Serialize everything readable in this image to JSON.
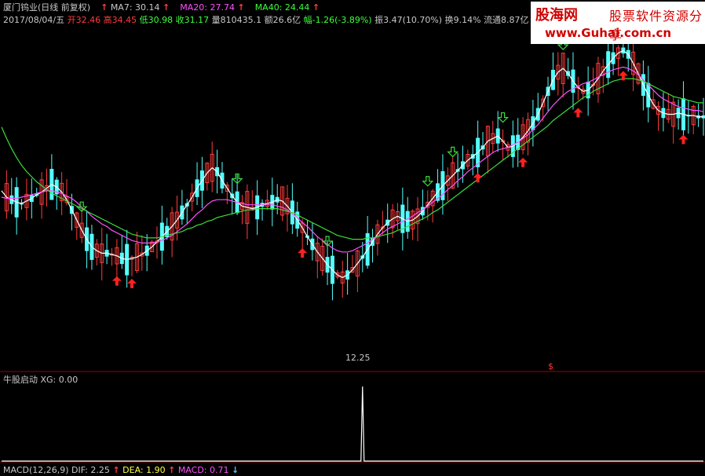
{
  "header": {
    "stock_name": "厦门钨业(日线 前复权)",
    "ma7_label": "MA7: 30.14",
    "ma20_label": "MA20: 27.74",
    "ma40_label": "MA40: 24.44",
    "date": "2017/08/04/五",
    "open": "开32.46",
    "high": "高34.45",
    "low": "低30.98",
    "close": "收31.17",
    "volume": "量810435.1",
    "amount": "额26.6亿",
    "change": "幅-1.26(-3.89%)",
    "amplitude": "振3.47(10.70%)",
    "turnover": "换9.14%",
    "float": "流通8.87亿"
  },
  "watermark": {
    "logo": "股海网",
    "subtitle": "股票软件资源分享",
    "url": "www.Guhai.com.cn"
  },
  "indicator": {
    "title": "牛股启动",
    "xg_label": "XG: 0.00"
  },
  "macd": {
    "label": "MACD(12,26,9)",
    "dif": "DIF: 2.25",
    "dea": "DEA: 1.90",
    "macd": "MACD: 0.71"
  },
  "arrows": {
    "up": "↑",
    "down": "↓"
  },
  "chart_data": {
    "type": "line",
    "title": "",
    "low_marker_label": "12.25",
    "signal_marker_label": "$",
    "colors": {
      "up_candle": "#ff3c3c",
      "down_candle": "#54ffff",
      "ma7": "#ffffff",
      "ma20": "#ff50ff",
      "ma40": "#3cdc3c",
      "buy_arrow": "#ff2020",
      "sell_arrow": "#3cdc3c",
      "xg_line": "#ffffff"
    },
    "y_range": [
      11.0,
      37.0
    ],
    "series": [
      {
        "name": "MA7",
        "values": [
          24.5,
          24.0,
          23.8,
          23.6,
          23.5,
          23.7,
          23.9,
          24.2,
          24.4,
          24.7,
          25.0,
          24.8,
          24.4,
          23.8,
          23.0,
          22.2,
          21.4,
          20.7,
          20.1,
          19.8,
          19.6,
          19.6,
          19.5,
          19.4,
          19.2,
          19.1,
          19.2,
          19.3,
          19.5,
          19.8,
          20.1,
          20.5,
          20.9,
          21.3,
          21.7,
          22.2,
          22.8,
          23.4,
          24.0,
          24.7,
          25.3,
          25.9,
          26.3,
          26.0,
          25.3,
          24.7,
          24.1,
          23.6,
          23.3,
          23.2,
          23.1,
          23.2,
          23.4,
          23.5,
          23.6,
          23.8,
          23.7,
          23.3,
          22.8,
          22.2,
          21.6,
          20.9,
          20.3,
          19.7,
          19.2,
          18.7,
          18.3,
          17.9,
          17.7,
          17.9,
          18.3,
          18.8,
          19.3,
          19.9,
          20.5,
          21.1,
          21.6,
          22.0,
          22.3,
          22.5,
          22.3,
          22.1,
          22.2,
          22.5,
          22.9,
          23.4,
          23.9,
          24.4,
          24.9,
          25.3,
          25.7,
          26.1,
          26.5,
          26.9,
          27.2,
          27.5,
          27.9,
          28.4,
          28.6,
          28.8,
          28.4,
          27.9,
          28.0,
          28.3,
          28.7,
          29.2,
          29.8,
          30.5,
          31.4,
          32.3,
          33.2,
          33.8,
          34.1,
          33.7,
          33.1,
          32.6,
          32.3,
          32.4,
          32.8,
          33.3,
          33.9,
          34.4,
          34.9,
          35.3,
          35.5,
          35.2,
          34.5,
          33.7,
          32.8,
          32.0,
          31.3,
          30.8,
          30.6,
          30.5,
          30.5,
          30.6,
          30.5,
          30.4,
          30.4,
          30.3,
          30.3
        ]
      },
      {
        "name": "MA20",
        "values": [
          24.0,
          23.9,
          23.9,
          23.9,
          24.0,
          24.1,
          24.2,
          24.3,
          24.4,
          24.5,
          24.5,
          24.4,
          24.3,
          24.1,
          23.9,
          23.6,
          23.2,
          22.9,
          22.5,
          22.2,
          21.9,
          21.7,
          21.4,
          21.2,
          21.0,
          20.8,
          20.6,
          20.5,
          20.4,
          20.4,
          20.4,
          20.5,
          20.6,
          20.8,
          21.0,
          21.3,
          21.6,
          21.9,
          22.3,
          22.7,
          23.0,
          23.4,
          23.7,
          23.8,
          23.8,
          23.8,
          23.7,
          23.6,
          23.5,
          23.4,
          23.4,
          23.4,
          23.4,
          23.4,
          23.4,
          23.3,
          23.2,
          23.0,
          22.7,
          22.4,
          22.0,
          21.7,
          21.3,
          20.9,
          20.6,
          20.3,
          20.0,
          19.8,
          19.7,
          19.7,
          19.8,
          20.0,
          20.2,
          20.4,
          20.7,
          20.9,
          21.2,
          21.5,
          21.7,
          21.9,
          22.1,
          22.3,
          22.5,
          22.8,
          23.0,
          23.3,
          23.6,
          23.9,
          24.2,
          24.6,
          24.9,
          25.3,
          25.6,
          26.0,
          26.3,
          26.6,
          26.9,
          27.2,
          27.5,
          27.7,
          27.8,
          27.9,
          28.1,
          28.3,
          28.6,
          28.9,
          29.3,
          29.7,
          30.2,
          30.7,
          31.2,
          31.6,
          32.0,
          32.3,
          32.5,
          32.7,
          32.9,
          33.0,
          33.2,
          33.4,
          33.6,
          33.8,
          34.0,
          34.1,
          34.2,
          34.1,
          33.9,
          33.6,
          33.2,
          32.8,
          32.4,
          32.0,
          31.7,
          31.5,
          31.3,
          31.1,
          31.0,
          30.9,
          30.8,
          30.8,
          30.7
        ]
      },
      {
        "name": "MA40",
        "values": [
          29.5,
          28.6,
          27.8,
          27.1,
          26.5,
          26.0,
          25.6,
          25.2,
          24.9,
          24.6,
          24.3,
          24.1,
          23.9,
          23.7,
          23.5,
          23.3,
          23.1,
          22.9,
          22.7,
          22.5,
          22.3,
          22.1,
          21.9,
          21.7,
          21.5,
          21.3,
          21.1,
          21.0,
          20.9,
          20.8,
          20.8,
          20.8,
          20.9,
          21.0,
          21.1,
          21.2,
          21.3,
          21.5,
          21.6,
          21.8,
          21.9,
          22.1,
          22.2,
          22.4,
          22.5,
          22.6,
          22.7,
          22.8,
          22.9,
          23.0,
          23.0,
          23.1,
          23.1,
          23.1,
          23.1,
          23.1,
          23.0,
          22.9,
          22.8,
          22.6,
          22.4,
          22.2,
          22.0,
          21.8,
          21.6,
          21.4,
          21.2,
          21.0,
          20.9,
          20.8,
          20.7,
          20.7,
          20.7,
          20.8,
          20.8,
          20.9,
          21.0,
          21.1,
          21.2,
          21.4,
          21.5,
          21.7,
          21.9,
          22.1,
          22.3,
          22.5,
          22.8,
          23.0,
          23.3,
          23.6,
          23.9,
          24.2,
          24.5,
          24.8,
          25.1,
          25.4,
          25.7,
          26.0,
          26.3,
          26.6,
          26.9,
          27.2,
          27.5,
          27.8,
          28.1,
          28.4,
          28.7,
          29.0,
          29.3,
          29.6,
          30.0,
          30.3,
          30.6,
          30.9,
          31.2,
          31.5,
          31.8,
          32.0,
          32.3,
          32.5,
          32.7,
          32.9,
          33.1,
          33.2,
          33.3,
          33.3,
          33.3,
          33.2,
          33.1,
          32.9,
          32.7,
          32.5,
          32.3,
          32.1,
          31.9,
          31.8,
          31.7,
          31.6,
          31.5,
          31.4,
          31.4
        ]
      }
    ],
    "buy_signals": [
      23,
      26,
      60,
      95,
      104,
      115,
      124,
      136,
      153,
      175,
      198
    ],
    "sell_signals": [
      16,
      47,
      65,
      85,
      90,
      100,
      112,
      123,
      147,
      177
    ],
    "signal_index": 120,
    "xg_spike_index": 72
  }
}
